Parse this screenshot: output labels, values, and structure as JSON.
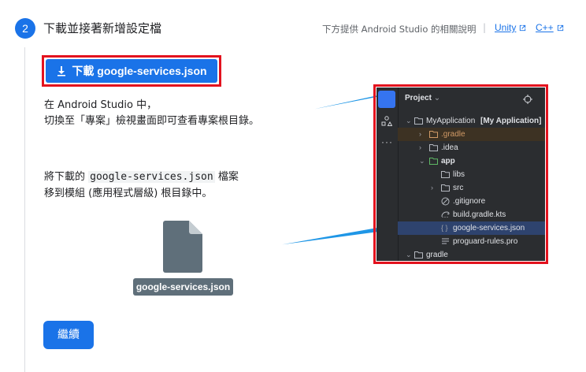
{
  "step": {
    "number": "2",
    "title": "下載並接著新增設定檔"
  },
  "help": {
    "text": "下方提供 Android Studio 的相關說明",
    "separator": "|",
    "unity_label": "Unity",
    "cpp_label": "C++"
  },
  "download_button": {
    "label": "下載 google-services.json"
  },
  "instructions": {
    "line1": "在 Android Studio 中，",
    "line2": "切換至「專案」檢視畫面即可查看專案根目錄。",
    "line3_prefix": "將下載的 ",
    "line3_code": "google-services.json",
    "line3_suffix": " 檔案",
    "line4": "移到模組 (應用程式層級) 根目錄中。"
  },
  "file_tile": {
    "label": "google-services.json"
  },
  "continue_button": {
    "label": "繼續"
  },
  "ide": {
    "panel_title": "Project",
    "rows": [
      {
        "name": "MyApplication",
        "suffix": "[My Application]"
      },
      {
        "name": ".gradle"
      },
      {
        "name": ".idea"
      },
      {
        "name": "app"
      },
      {
        "name": "libs"
      },
      {
        "name": "src"
      },
      {
        "name": ".gitignore"
      },
      {
        "name": "build.gradle.kts"
      },
      {
        "name": "google-services.json"
      },
      {
        "name": "proguard-rules.pro"
      },
      {
        "name": "gradle"
      }
    ]
  },
  "colors": {
    "accent": "#1a73e8",
    "highlight": "#e3121e",
    "arrow": "#1e96e6"
  }
}
